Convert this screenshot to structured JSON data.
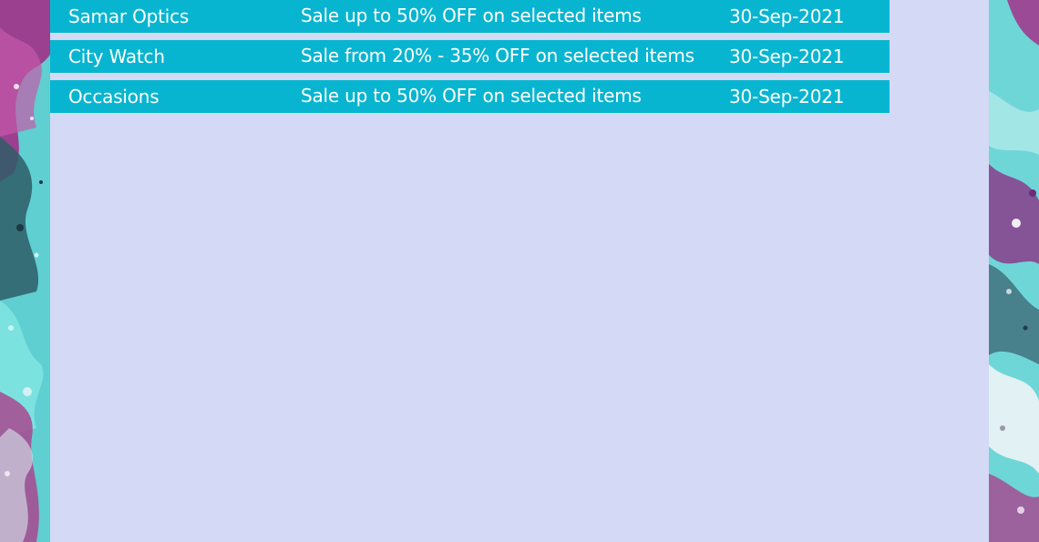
{
  "offers": [
    {
      "store": "Samar Optics",
      "description": "Sale up to 50% OFF on selected items",
      "expiry": "30-Sep-2021"
    },
    {
      "store": "City Watch",
      "description": "Sale from 20% - 35% OFF on selected items",
      "expiry": "30-Sep-2021"
    },
    {
      "store": "Occasions",
      "description": "Sale up to 50% OFF on selected items",
      "expiry": "30-Sep-2021"
    }
  ],
  "colors": {
    "page_background": "#d4d9f5",
    "row_background": "#08b5d1",
    "row_text": "#ffffff",
    "art_teal": "#5fd3d6",
    "art_purple": "#8b3f87",
    "art_dark": "#2c4f5c"
  }
}
